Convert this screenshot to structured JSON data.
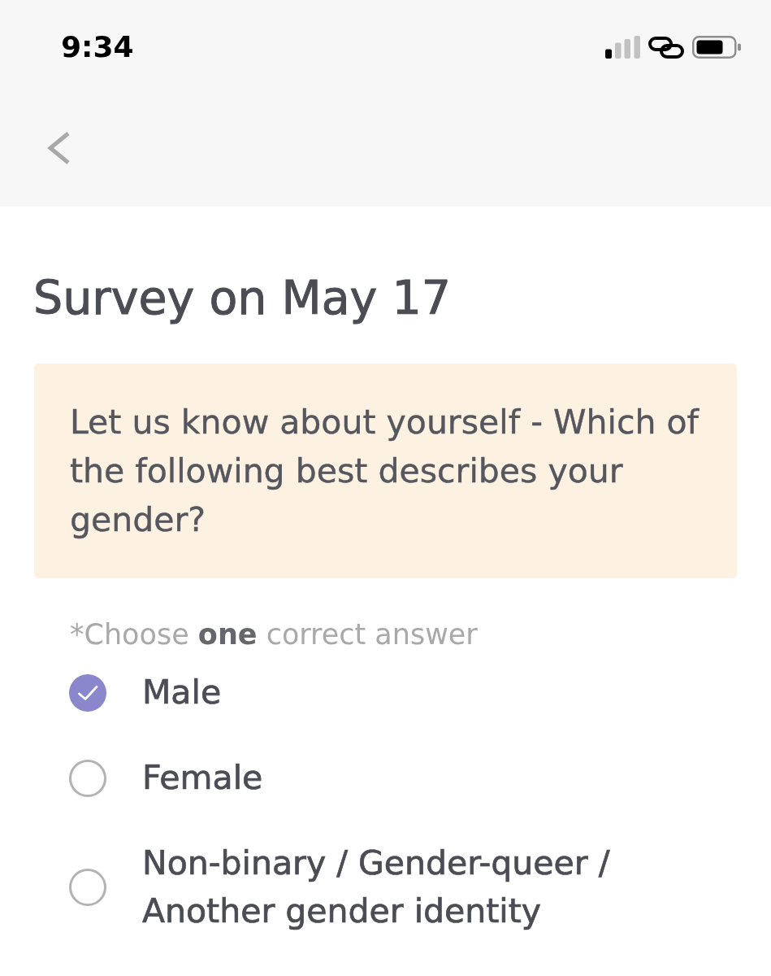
{
  "status_bar": {
    "time": "9:34"
  },
  "title": "Survey on May 17",
  "question": "Let us know about yourself - Which of the following best describes your gender?",
  "hint": "*Choose **one** correct answer",
  "options": [
    {
      "label": "Male",
      "selected": true
    },
    {
      "label": "Female",
      "selected": false
    },
    {
      "label": "Non-binary / Gender-queer / Another gender identity",
      "selected": false
    }
  ]
}
